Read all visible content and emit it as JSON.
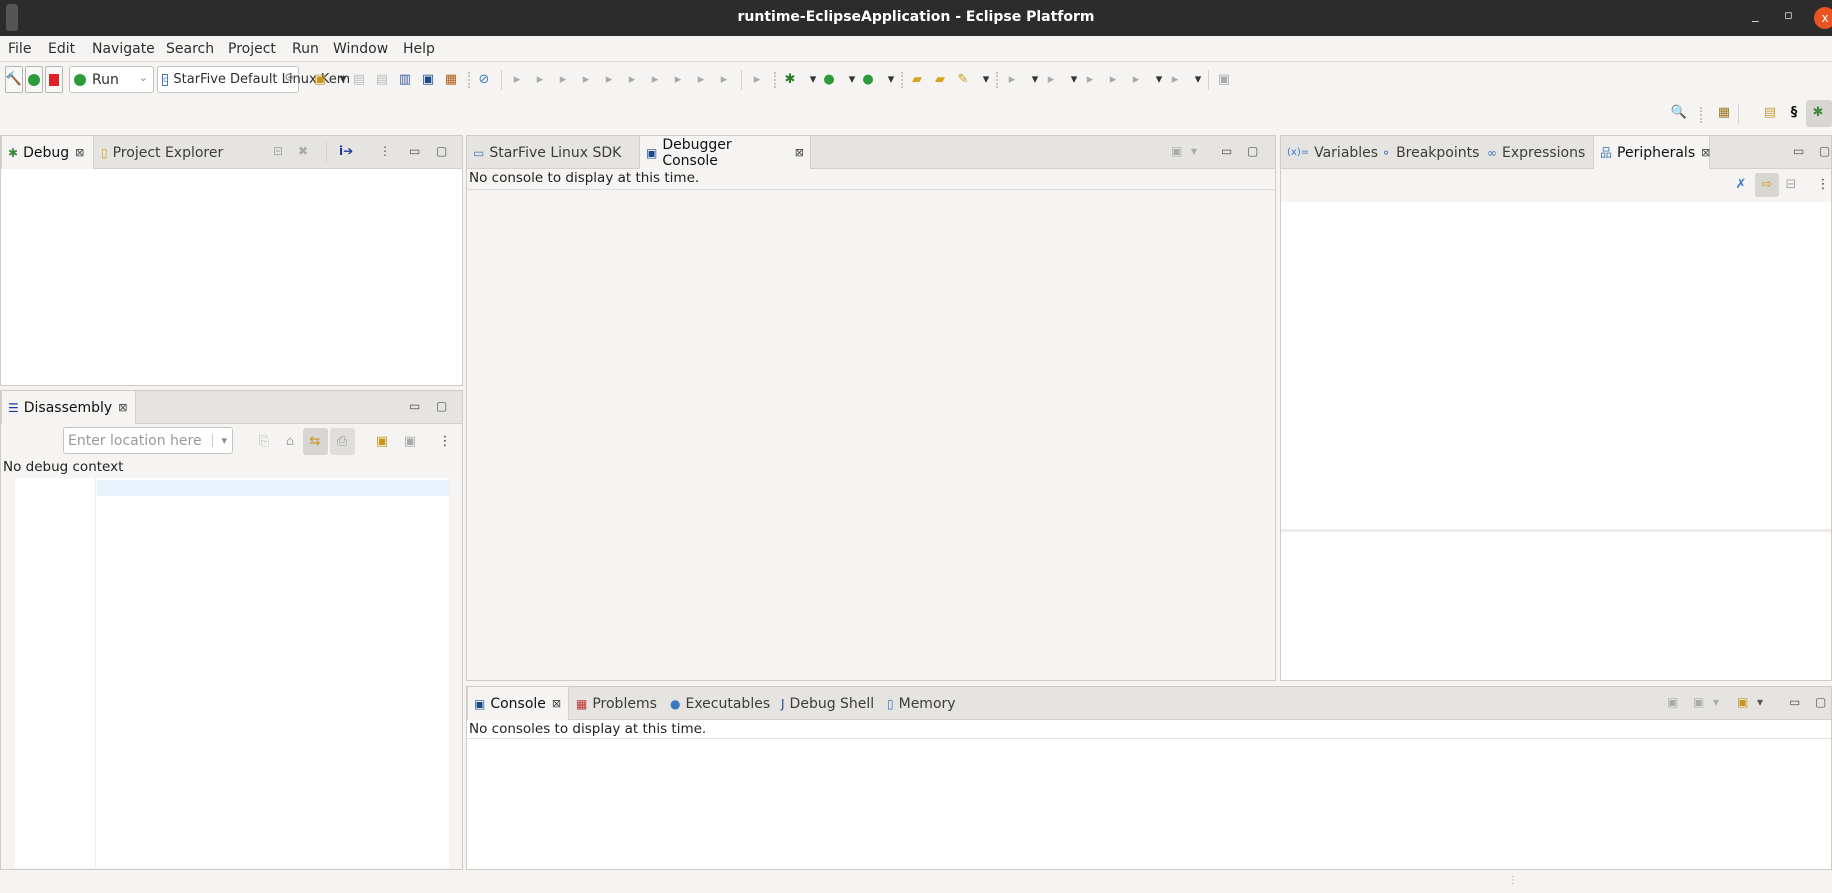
{
  "window": {
    "title": "runtime-EclipseApplication - Eclipse Platform",
    "minimize": "_",
    "restore": "▫",
    "close": "x"
  },
  "menu": [
    "File",
    "Edit",
    "Navigate",
    "Search",
    "Project",
    "Run",
    "Window",
    "Help"
  ],
  "toolbar": {
    "run_mode": "Run",
    "launch_target": "StarFive Default Linux Kern",
    "icons": [
      "new-icon",
      "dropdown-icon",
      "save-icon",
      "save-all-icon",
      "binary-icon",
      "console-icon",
      "build-icon",
      "skip-breakpoints-icon",
      "resume-icon",
      "suspend-icon",
      "terminate-icon",
      "disconnect-icon",
      "step-into-icon",
      "step-over-icon",
      "step-return-icon",
      "instruction-step-icon",
      "use-step-filters-icon",
      "drop-to-frame-icon",
      "refresh-icon",
      "debug-icon",
      "dropdown-icon",
      "run-icon",
      "dropdown-icon",
      "run-external-tool-icon",
      "dropdown-icon",
      "open-project-icon",
      "open-file-icon",
      "pencil-icon",
      "dropdown-icon",
      "next-annotation-icon",
      "dropdown-icon",
      "prev-annotation-icon",
      "dropdown-icon",
      "last-edit-icon",
      "forward-edit-icon",
      "back-icon",
      "dropdown-icon",
      "forward-icon",
      "dropdown-icon",
      "pin-editor-icon"
    ]
  },
  "debug_panel": {
    "tabs": [
      {
        "label": "Debug",
        "active": true
      },
      {
        "label": "Project Explorer",
        "active": false
      }
    ]
  },
  "disassembly": {
    "tab": "Disassembly",
    "location_placeholder": "Enter location here",
    "status": "No debug context"
  },
  "editor": {
    "tabs": [
      {
        "label": "StarFive Linux SDK",
        "active": false
      },
      {
        "label": "Debugger Console",
        "active": true
      }
    ],
    "message": "No console to display at this time."
  },
  "right_panel": {
    "tabs": [
      {
        "label": "Variables"
      },
      {
        "label": "Breakpoints"
      },
      {
        "label": "Expressions"
      },
      {
        "label": "Peripherals",
        "active": true
      }
    ]
  },
  "console": {
    "tabs": [
      {
        "label": "Console",
        "active": true
      },
      {
        "label": "Problems"
      },
      {
        "label": "Executables"
      },
      {
        "label": "Debug Shell"
      },
      {
        "label": "Memory"
      }
    ],
    "message": "No consoles to display at this time."
  }
}
